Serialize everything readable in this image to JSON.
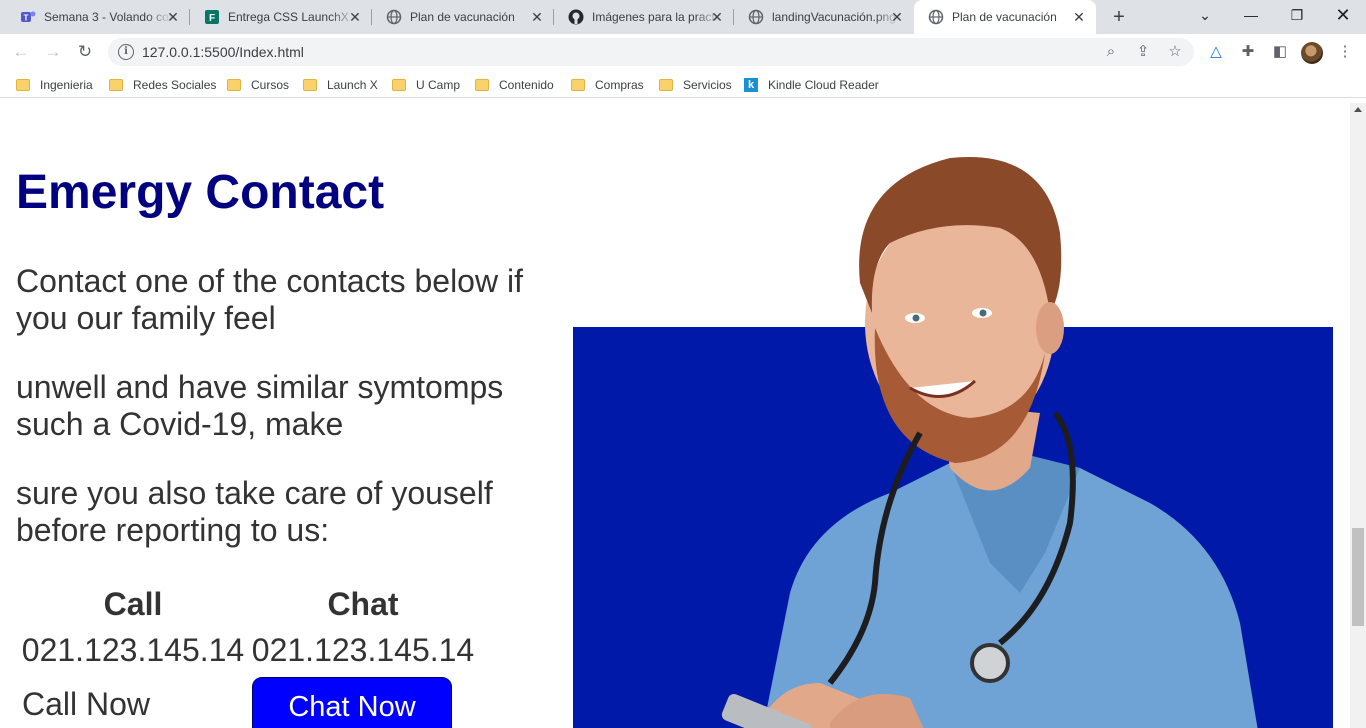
{
  "browser": {
    "tabs": [
      {
        "title": "Semana 3 - Volando con CSS",
        "icon": "teams-icon",
        "active": false
      },
      {
        "title": "Entrega CSS LaunchX",
        "icon": "forms-icon",
        "active": false
      },
      {
        "title": "Plan de vacunación",
        "icon": "globe-icon",
        "active": false
      },
      {
        "title": "Imágenes para la practica",
        "icon": "github-icon",
        "active": false
      },
      {
        "title": "landingVacunación.png",
        "icon": "globe-icon",
        "active": false
      },
      {
        "title": "Plan de vacunación",
        "icon": "globe-icon",
        "active": true
      }
    ],
    "url": "127.0.0.1:5500/Index.html",
    "bookmarks": [
      {
        "label": "Ingenieria",
        "icon": "folder-icon"
      },
      {
        "label": "Redes Sociales",
        "icon": "folder-icon"
      },
      {
        "label": "Cursos",
        "icon": "folder-icon"
      },
      {
        "label": "Launch X",
        "icon": "folder-icon"
      },
      {
        "label": "U Camp",
        "icon": "folder-icon"
      },
      {
        "label": "Contenido",
        "icon": "folder-icon"
      },
      {
        "label": "Compras",
        "icon": "folder-icon"
      },
      {
        "label": "Servicios",
        "icon": "folder-icon"
      },
      {
        "label": "Kindle Cloud Reader",
        "icon": "kindle-icon"
      }
    ]
  },
  "page": {
    "heading": "Emergy Contact",
    "paragraphs": [
      "Contact one of the contacts below if you our family feel",
      "unwell and have similar symtomps such a Covid-19, make",
      "sure you also take care of youself before reporting to us:"
    ],
    "contacts": {
      "call": {
        "label": "Call",
        "number": "021.123.145.14",
        "action": "Call Now"
      },
      "chat": {
        "label": "Chat",
        "number": "021.123.145.14",
        "action": "Chat Now"
      }
    },
    "colors": {
      "heading": "#000080",
      "panel": "#0019a8",
      "button": "#0000ff"
    }
  }
}
